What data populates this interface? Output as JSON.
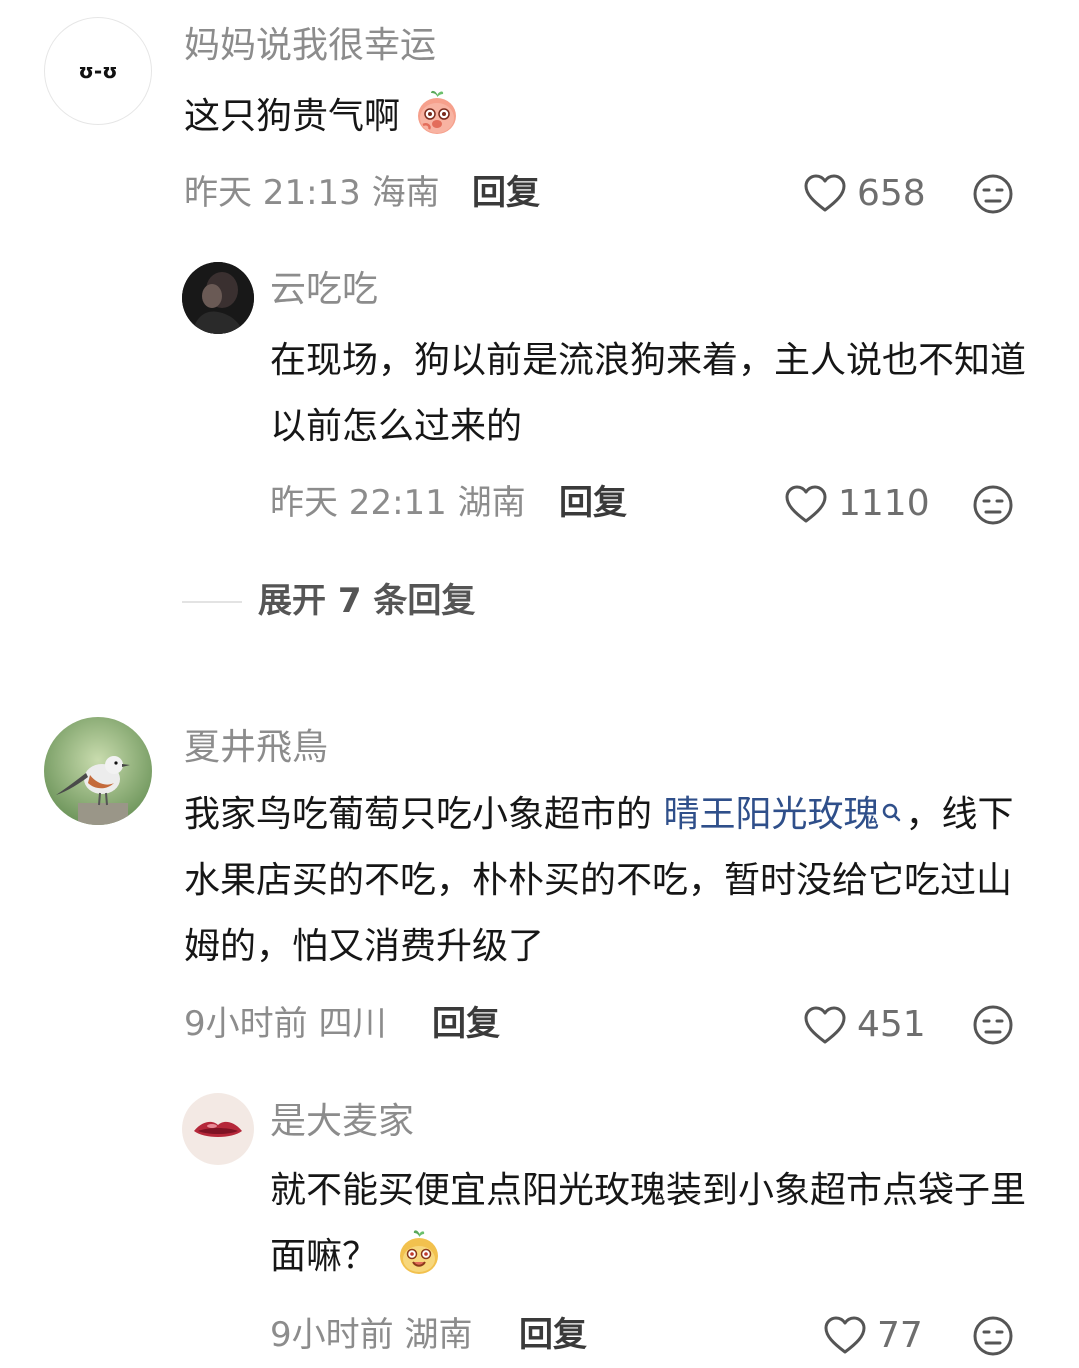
{
  "comments": [
    {
      "username": "妈妈说我很幸运",
      "avatar_text": "ʊ-ʊ",
      "text": "这只狗贵气啊",
      "emoji": "shy-peach-emoji",
      "time": "昨天 21:13",
      "location": "海南",
      "reply_label": "回复",
      "likes": "658",
      "replies": [
        {
          "username": "云吃吃",
          "text": "在现场，狗以前是流浪狗来着，主人说也不知道以前怎么过来的",
          "time": "昨天 22:11",
          "location": "湖南",
          "reply_label": "回复",
          "likes": "1110"
        }
      ],
      "expand_label": "展开 7 条回复"
    },
    {
      "username": "夏井飛鳥",
      "text_before_link": "我家鸟吃葡萄只吃小象超市的 ",
      "link_text": "晴王阳光玫瑰",
      "text_after_link": "，线下水果店买的不吃，朴朴买的不吃，暂时没给它吃过山姆的，怕又消费升级了",
      "time": "9小时前",
      "location": "四川",
      "reply_label": "回复",
      "likes": "451",
      "replies": [
        {
          "username": "是大麦家",
          "text": "就不能买便宜点阳光玫瑰装到小象超市点袋子里面嘛？",
          "emoji": "smiling-potato-emoji",
          "time": "9小时前",
          "location": "湖南",
          "reply_label": "回复",
          "likes": "77"
        }
      ]
    }
  ],
  "colors": {
    "meta_gray": "#8c8c8c",
    "text": "#161616",
    "link": "#2f4f8a"
  }
}
